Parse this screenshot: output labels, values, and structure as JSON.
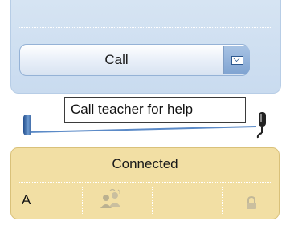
{
  "call_panel": {
    "call_label": "Call",
    "mail_icon": "mail-icon"
  },
  "tooltip": {
    "text": "Call teacher for help"
  },
  "volume": {
    "level": 0.0,
    "mic_icon": "microphone-icon"
  },
  "status": {
    "text": "Connected",
    "seat": "A",
    "people_icon": "group-chat-icon",
    "lock_icon": "lock-icon"
  },
  "colors": {
    "call_panel_bg": "#cfe0f2",
    "status_panel_bg": "#f2dfa4",
    "accent": "#2c5890"
  }
}
